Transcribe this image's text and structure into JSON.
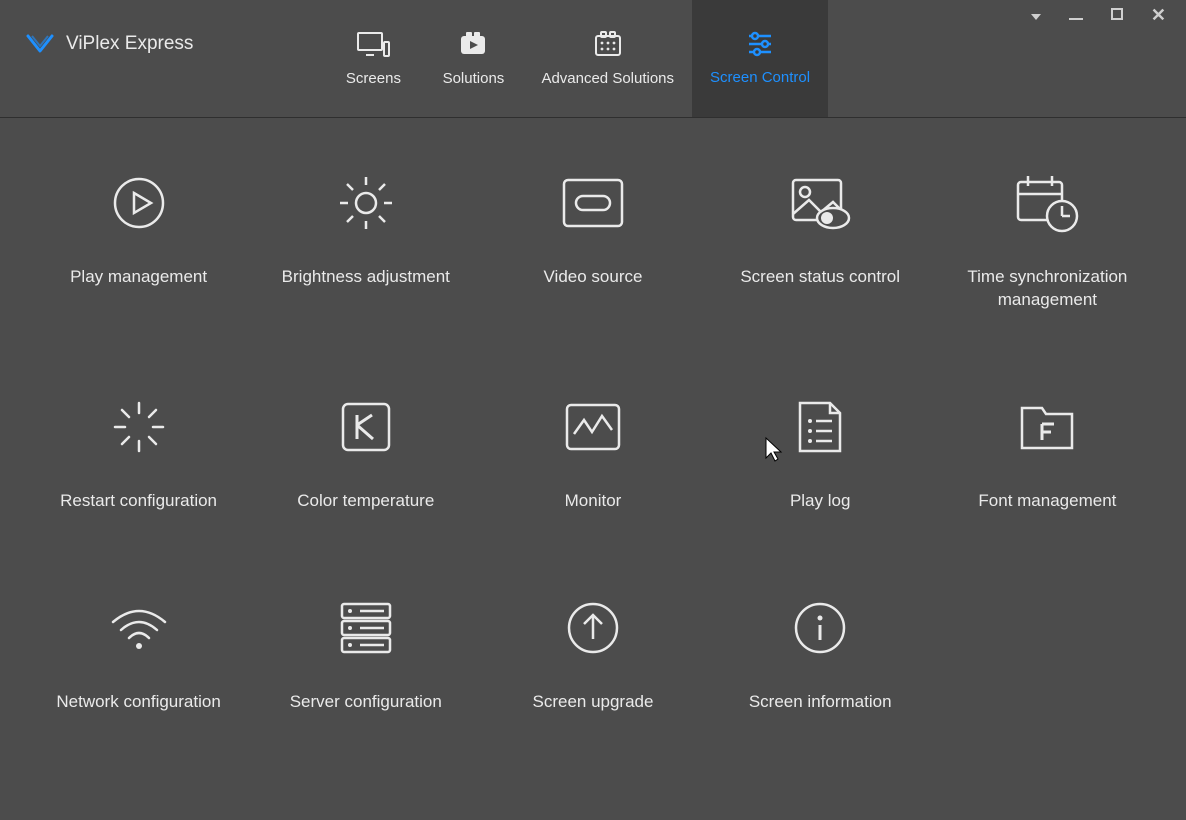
{
  "app": {
    "title": "ViPlex Express"
  },
  "tabs": {
    "screens": "Screens",
    "solutions": "Solutions",
    "advanced": "Advanced Solutions",
    "screen_control": "Screen Control"
  },
  "tiles": {
    "play_management": "Play management",
    "brightness": "Brightness adjustment",
    "video_source": "Video source",
    "screen_status": "Screen status control",
    "time_sync": "Time synchronization management",
    "restart_config": "Restart configuration",
    "color_temp": "Color temperature",
    "monitor": "Monitor",
    "play_log": "Play log",
    "font_mgmt": "Font management",
    "network_config": "Network configuration",
    "server_config": "Server configuration",
    "screen_upgrade": "Screen upgrade",
    "screen_info": "Screen information"
  }
}
